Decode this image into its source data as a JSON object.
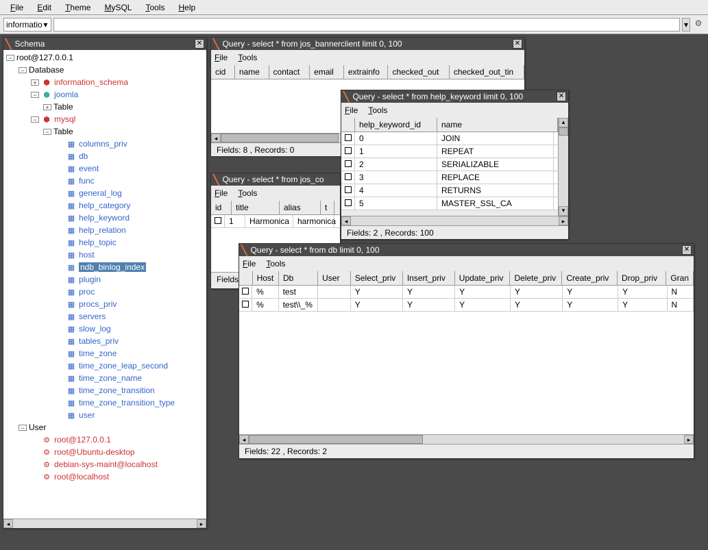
{
  "menubar": [
    "File",
    "Edit",
    "Theme",
    "MySQL",
    "Tools",
    "Help"
  ],
  "toolbar": {
    "combo_value": "informatio"
  },
  "schema": {
    "title": "Schema",
    "root": "root@127.0.0.1",
    "database_label": "Database",
    "databases": [
      "information_schema",
      "joomla",
      "mysql"
    ],
    "table_label": "Table",
    "mysql_tables": [
      "columns_priv",
      "db",
      "event",
      "func",
      "general_log",
      "help_category",
      "help_keyword",
      "help_relation",
      "help_topic",
      "host",
      "ndb_binlog_index",
      "plugin",
      "proc",
      "procs_priv",
      "servers",
      "slow_log",
      "tables_priv",
      "time_zone",
      "time_zone_leap_second",
      "time_zone_name",
      "time_zone_transition",
      "time_zone_transition_type",
      "user"
    ],
    "selected_table": "ndb_binlog_index",
    "user_label": "User",
    "users": [
      "root@127.0.0.1",
      "root@Ubuntu-desktop",
      "debian-sys-maint@localhost",
      "root@localhost"
    ]
  },
  "q1": {
    "title": "Query - select * from jos_bannerclient limit 0, 100",
    "menu": [
      "File",
      "Tools"
    ],
    "cols": [
      "cid",
      "name",
      "contact",
      "email",
      "extrainfo",
      "checked_out",
      "checked_out_tin"
    ],
    "status": "Fields: 8 , Records: 0"
  },
  "q2": {
    "title": "Query - select * from jos_co",
    "menu": [
      "File",
      "Tools"
    ],
    "cols": [
      "id",
      "title",
      "alias",
      "t"
    ],
    "row": [
      "1",
      "Harmonica",
      "harmonica"
    ],
    "status_label": "Fields"
  },
  "q3": {
    "title": "Query - select * from help_keyword limit 0, 100",
    "menu": [
      "File",
      "Tools"
    ],
    "cols": [
      "help_keyword_id",
      "name"
    ],
    "rows": [
      [
        "0",
        "JOIN"
      ],
      [
        "1",
        "REPEAT"
      ],
      [
        "2",
        "SERIALIZABLE"
      ],
      [
        "3",
        "REPLACE"
      ],
      [
        "4",
        "RETURNS"
      ],
      [
        "5",
        "MASTER_SSL_CA"
      ]
    ],
    "status": "Fields: 2 , Records: 100"
  },
  "q4": {
    "title": "Query - select * from db limit 0, 100",
    "menu": [
      "File",
      "Tools"
    ],
    "cols": [
      "Host",
      "Db",
      "User",
      "Select_priv",
      "Insert_priv",
      "Update_priv",
      "Delete_priv",
      "Create_priv",
      "Drop_priv",
      "Gran"
    ],
    "rows": [
      [
        "%",
        "test",
        "",
        "Y",
        "Y",
        "Y",
        "Y",
        "Y",
        "Y",
        "N"
      ],
      [
        "%",
        "test\\\\_%",
        "",
        "Y",
        "Y",
        "Y",
        "Y",
        "Y",
        "Y",
        "N"
      ]
    ],
    "status": "Fields: 22 , Records: 2"
  }
}
